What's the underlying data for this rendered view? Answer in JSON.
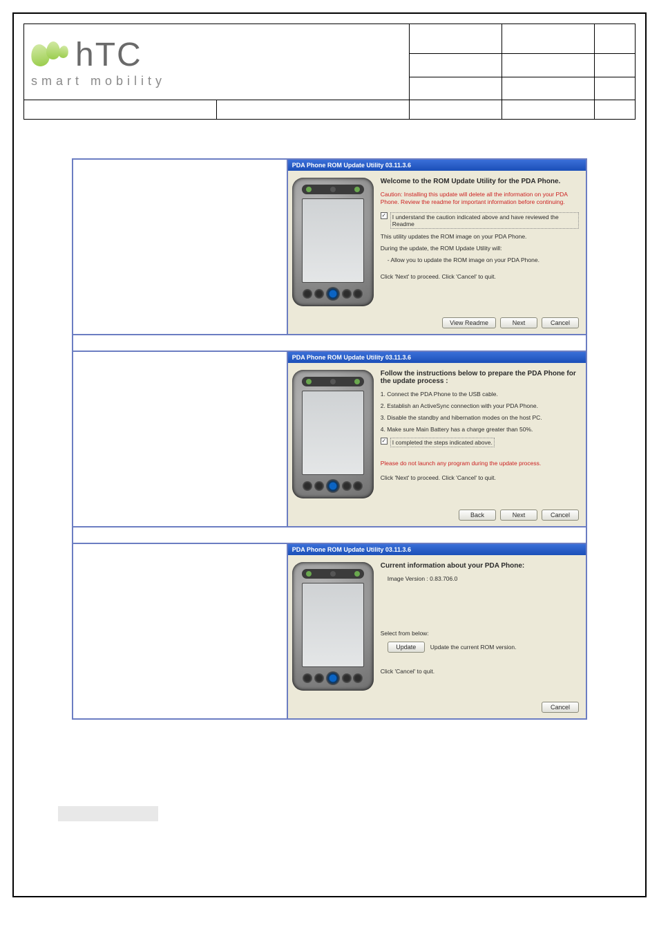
{
  "brand": {
    "name": "hTC",
    "tagline": "smart mobility"
  },
  "dialogs": {
    "d1": {
      "title": "PDA Phone ROM Update Utility 03.11.3.6",
      "heading": "Welcome to the ROM Update Utility for the PDA Phone.",
      "caution": "Caution: Installing this update will delete all the information on your PDA Phone. Review the readme for important information before continuing.",
      "check_label": "I understand the caution indicated above and have reviewed the Readme",
      "line1": "This utility updates the ROM image on your PDA Phone.",
      "line2": "During the update, the ROM Update Utility will:",
      "bullet": "Allow you to update the ROM image on your PDA Phone.",
      "line3": "Click 'Next' to proceed. Click 'Cancel' to quit.",
      "btn_readme": "View Readme",
      "btn_next": "Next",
      "btn_cancel": "Cancel"
    },
    "d2": {
      "title": "PDA Phone ROM Update Utility 03.11.3.6",
      "heading": "Follow the instructions below to prepare the PDA Phone for the update process :",
      "s1": "1. Connect the PDA Phone to the USB cable.",
      "s2": "2. Establish an ActiveSync connection with your PDA Phone.",
      "s3": "3. Disable the standby and hibernation modes on the host PC.",
      "s4": "4. Make sure Main Battery has a charge greater than 50%.",
      "check_label": "I completed the steps indicated above.",
      "warn": "Please do not launch any program during the update process.",
      "line_end": "Click 'Next' to proceed. Click 'Cancel' to quit.",
      "btn_back": "Back",
      "btn_next": "Next",
      "btn_cancel": "Cancel"
    },
    "d3": {
      "title": "PDA Phone ROM Update Utility 03.11.3.6",
      "heading": "Current information about your PDA Phone:",
      "version_line": "Image Version : 0.83.706.0",
      "select_label": "Select from below:",
      "btn_update": "Update",
      "update_desc": "Update the current ROM version.",
      "line_end": "Click 'Cancel' to quit.",
      "btn_cancel": "Cancel"
    }
  }
}
